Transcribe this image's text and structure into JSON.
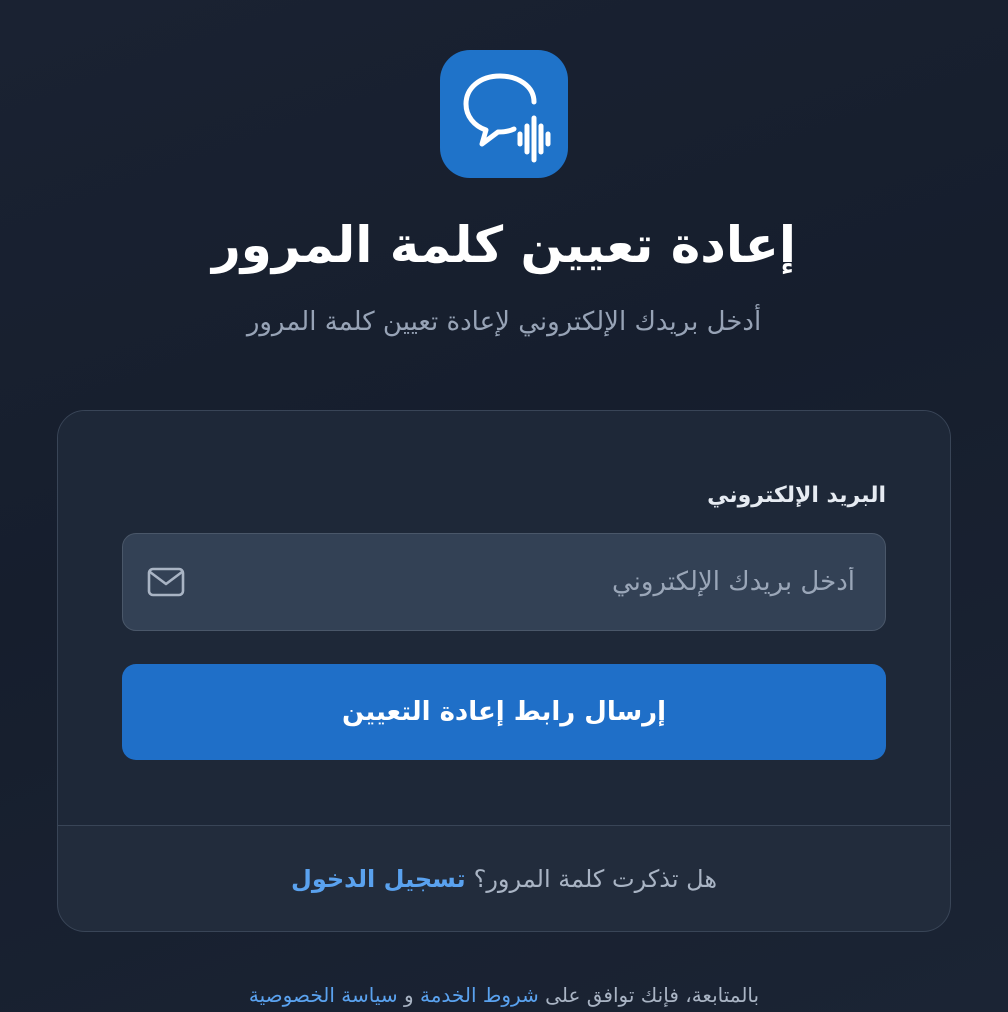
{
  "header": {
    "logo_icon": "chat-bubble-sound-wave-icon",
    "title": "إعادة تعيين كلمة المرور",
    "subtitle": "أدخل بريدك الإلكتروني لإعادة تعيين كلمة المرور"
  },
  "form": {
    "email_label": "البريد الإلكتروني",
    "email_placeholder": "أدخل بريدك الإلكتروني",
    "email_value": "",
    "email_icon": "mail-icon",
    "submit_label": "إرسال رابط إعادة التعيين"
  },
  "footer": {
    "question": "هل تذكرت كلمة المرور؟",
    "login_link": "تسجيل الدخول"
  },
  "legal": {
    "prefix": "بالمتابعة، فإنك توافق على",
    "terms_link": "شروط الخدمة",
    "conjunction": "و",
    "privacy_link": "سياسة الخصوصية"
  },
  "colors": {
    "accent": "#1f6fc8",
    "link": "#5aa2ef",
    "background": "#1a2232"
  }
}
